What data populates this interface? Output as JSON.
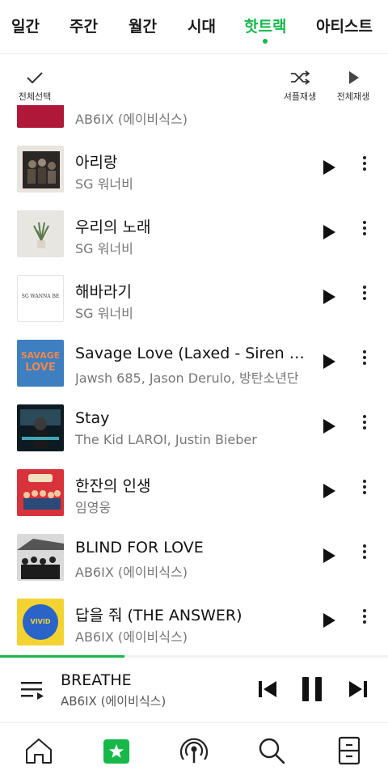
{
  "tabs": [
    {
      "label": "일간",
      "active": false
    },
    {
      "label": "주간",
      "active": false
    },
    {
      "label": "월간",
      "active": false
    },
    {
      "label": "시대",
      "active": false
    },
    {
      "label": "핫트랙",
      "active": true
    },
    {
      "label": "아티스트",
      "active": false
    }
  ],
  "toolbar": {
    "select_all": "전체선택",
    "shuffle": "셔플재생",
    "play_all": "전체재생"
  },
  "songs": [
    {
      "title": "",
      "artist": "AB6IX (에이비식스)",
      "art_icon": "album-art"
    },
    {
      "title": "아리랑",
      "artist": "SG 워너비",
      "art_icon": "album-art"
    },
    {
      "title": "우리의 노래",
      "artist": "SG 워너비",
      "art_icon": "album-art"
    },
    {
      "title": "해바라기",
      "artist": "SG 워너비",
      "art_text": "SG WANNA BE",
      "art_icon": "album-art"
    },
    {
      "title": "Savage Love (Laxed - Siren Beat)",
      "artist": "Jawsh 685, Jason Derulo, 방탄소년단",
      "art_text1": "SAVAGE",
      "art_text2": "LOVE",
      "art_icon": "album-art"
    },
    {
      "title": "Stay",
      "artist": "The Kid LAROI, Justin Bieber",
      "art_icon": "album-art"
    },
    {
      "title": "한잔의 인생",
      "artist": "임영웅",
      "art_icon": "album-art"
    },
    {
      "title": "BLIND FOR LOVE",
      "artist": "AB6IX (에이비식스)",
      "art_icon": "album-art"
    },
    {
      "title": "답을 줘 (THE ANSWER)",
      "artist": "AB6IX (에이비식스)",
      "art_text": "VIVID",
      "art_icon": "album-art"
    }
  ],
  "player": {
    "title": "BREATHE",
    "artist": "AB6IX (에이비식스)",
    "progress": 0.32
  },
  "colors": {
    "accent": "#16b84a"
  },
  "nav": [
    "home-icon",
    "chart-star-icon",
    "podcast-icon",
    "search-icon",
    "storage-icon"
  ]
}
